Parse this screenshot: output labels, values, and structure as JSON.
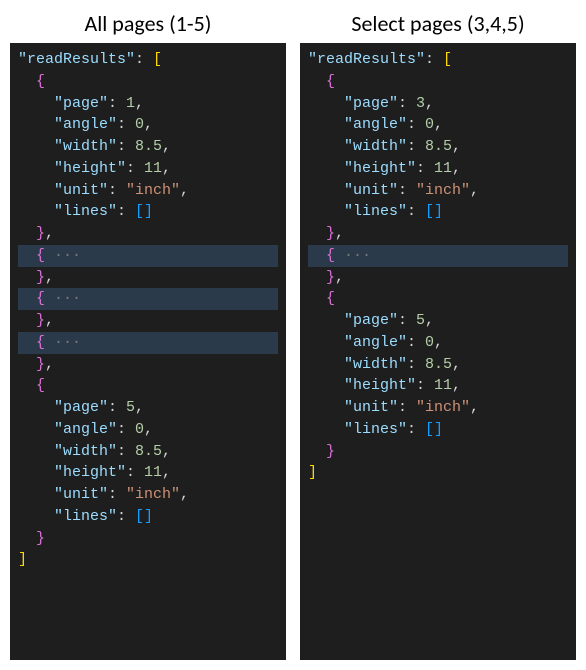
{
  "columns": [
    {
      "title": "All pages (1-5)",
      "json_key": "readResults",
      "pages": [
        {
          "expanded": true,
          "fields": {
            "page": 1,
            "angle": 0,
            "width": 8.5,
            "height": 11,
            "unit": "inch",
            "lines": []
          }
        },
        {
          "expanded": false
        },
        {
          "expanded": false
        },
        {
          "expanded": false
        },
        {
          "expanded": true,
          "fields": {
            "page": 5,
            "angle": 0,
            "width": 8.5,
            "height": 11,
            "unit": "inch",
            "lines": []
          }
        }
      ]
    },
    {
      "title": "Select pages (3,4,5)",
      "json_key": "readResults",
      "pages": [
        {
          "expanded": true,
          "fields": {
            "page": 3,
            "angle": 0,
            "width": 8.5,
            "height": 11,
            "unit": "inch",
            "lines": []
          }
        },
        {
          "expanded": false
        },
        {
          "expanded": true,
          "fields": {
            "page": 5,
            "angle": 0,
            "width": 8.5,
            "height": 11,
            "unit": "inch",
            "lines": []
          }
        }
      ]
    }
  ]
}
